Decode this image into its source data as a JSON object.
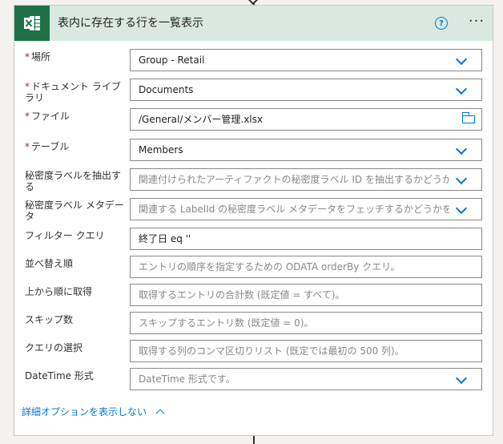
{
  "header": {
    "title": "表内に存在する行を一覧表示",
    "help_label": "?",
    "more_label": "···"
  },
  "fields": [
    {
      "label": "場所",
      "required": true,
      "value": "Group - Retail",
      "placeholder": "",
      "control": "dropdown"
    },
    {
      "label": "ドキュメント ライブラリ",
      "required": true,
      "value": "Documents",
      "placeholder": "",
      "control": "dropdown"
    },
    {
      "label": "ファイル",
      "required": true,
      "value": "/General/メンバー管理.xlsx",
      "placeholder": "",
      "control": "file-picker"
    },
    {
      "label": "テーブル",
      "required": true,
      "value": "Members",
      "placeholder": "",
      "control": "dropdown"
    },
    {
      "label": "秘密度ラベルを抽出する",
      "required": false,
      "value": "",
      "placeholder": "関連付けられたアーティファクトの秘密度ラベル ID を抽出するかどうか",
      "control": "dropdown"
    },
    {
      "label": "秘密度ラベル メタデータ",
      "required": false,
      "value": "",
      "placeholder": "関連する LabelId の秘密度ラベル メタデータをフェッチするかどうかを",
      "control": "dropdown"
    },
    {
      "label": "フィルター クエリ",
      "required": false,
      "value": "終了日 eq ''",
      "placeholder": "",
      "control": "text"
    },
    {
      "label": "並べ替え順",
      "required": false,
      "value": "",
      "placeholder": "エントリの順序を指定するための ODATA orderBy クエリ。",
      "control": "text"
    },
    {
      "label": "上から順に取得",
      "required": false,
      "value": "",
      "placeholder": "取得するエントリの合計数 (既定値 = すべて)。",
      "control": "text"
    },
    {
      "label": "スキップ数",
      "required": false,
      "value": "",
      "placeholder": "スキップするエントリ数 (既定値 = 0)。",
      "control": "text"
    },
    {
      "label": "クエリの選択",
      "required": false,
      "value": "",
      "placeholder": "取得する列のコンマ区切りリスト (既定では最初の 500 列)。",
      "control": "text"
    },
    {
      "label": "DateTime 形式",
      "required": false,
      "value": "",
      "placeholder": "DateTime 形式です。",
      "control": "dropdown"
    }
  ],
  "advanced_toggle": {
    "label": "詳細オプションを表示しない"
  },
  "icons": {
    "app": "excel-icon",
    "help": "help-icon",
    "more": "more-icon",
    "chevron": "chevron-down-icon",
    "folder": "folder-icon"
  },
  "colors": {
    "accent": "#0078d4",
    "header_bg": "#d9e9e2",
    "excel_green": "#1e7145",
    "required": "#a4262c"
  }
}
